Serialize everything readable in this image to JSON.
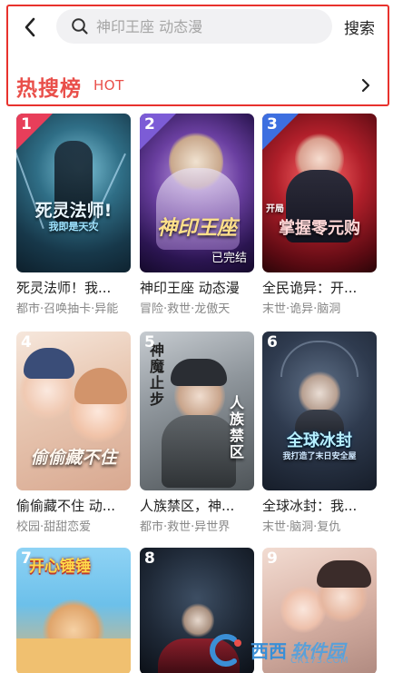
{
  "search": {
    "placeholder": "神印王座 动态漫",
    "button_label": "搜索"
  },
  "hot": {
    "title": "热搜榜",
    "subtitle": "HOT"
  },
  "items": [
    {
      "rank": "1",
      "title": "死灵法师！我...",
      "tags": "都市·召唤抽卡·异能",
      "cover_text": "死灵法师!",
      "cover_text2": "我即是天灾"
    },
    {
      "rank": "2",
      "title": "神印王座 动态漫",
      "tags": "冒险·救世·龙傲天",
      "cover_text": "神印王座",
      "badge": "已完结"
    },
    {
      "rank": "3",
      "title": "全民诡异：开...",
      "tags": "末世·诡异·脑洞",
      "cover_text": "掌握零元购",
      "cover_text2": "开局"
    },
    {
      "rank": "4",
      "title": "偷偷藏不住 动...",
      "tags": "校园·甜甜恋爱",
      "cover_text": "偷偷藏不住"
    },
    {
      "rank": "5",
      "title": "人族禁区，神...",
      "tags": "都市·救世·异世界",
      "cover_text": "神魔止步",
      "cover_text2": "人族禁区"
    },
    {
      "rank": "6",
      "title": "全球冰封：我...",
      "tags": "末世·脑洞·复仇",
      "cover_text": "全球冰封",
      "cover_text2": "我打造了末日安全屋"
    },
    {
      "rank": "7",
      "title": "",
      "tags": "",
      "cover_text": "开心锤锤"
    },
    {
      "rank": "8",
      "title": "",
      "tags": "",
      "cover_text": ""
    },
    {
      "rank": "9",
      "title": "",
      "tags": "",
      "cover_text": ""
    }
  ],
  "watermark": {
    "text": "西西",
    "text2": "软件园",
    "url": "CR173.COM"
  },
  "colors": {
    "accent_red": "#e94f4a",
    "rank_badge": "#e83e5a",
    "highlight_border": "#e8322d"
  }
}
